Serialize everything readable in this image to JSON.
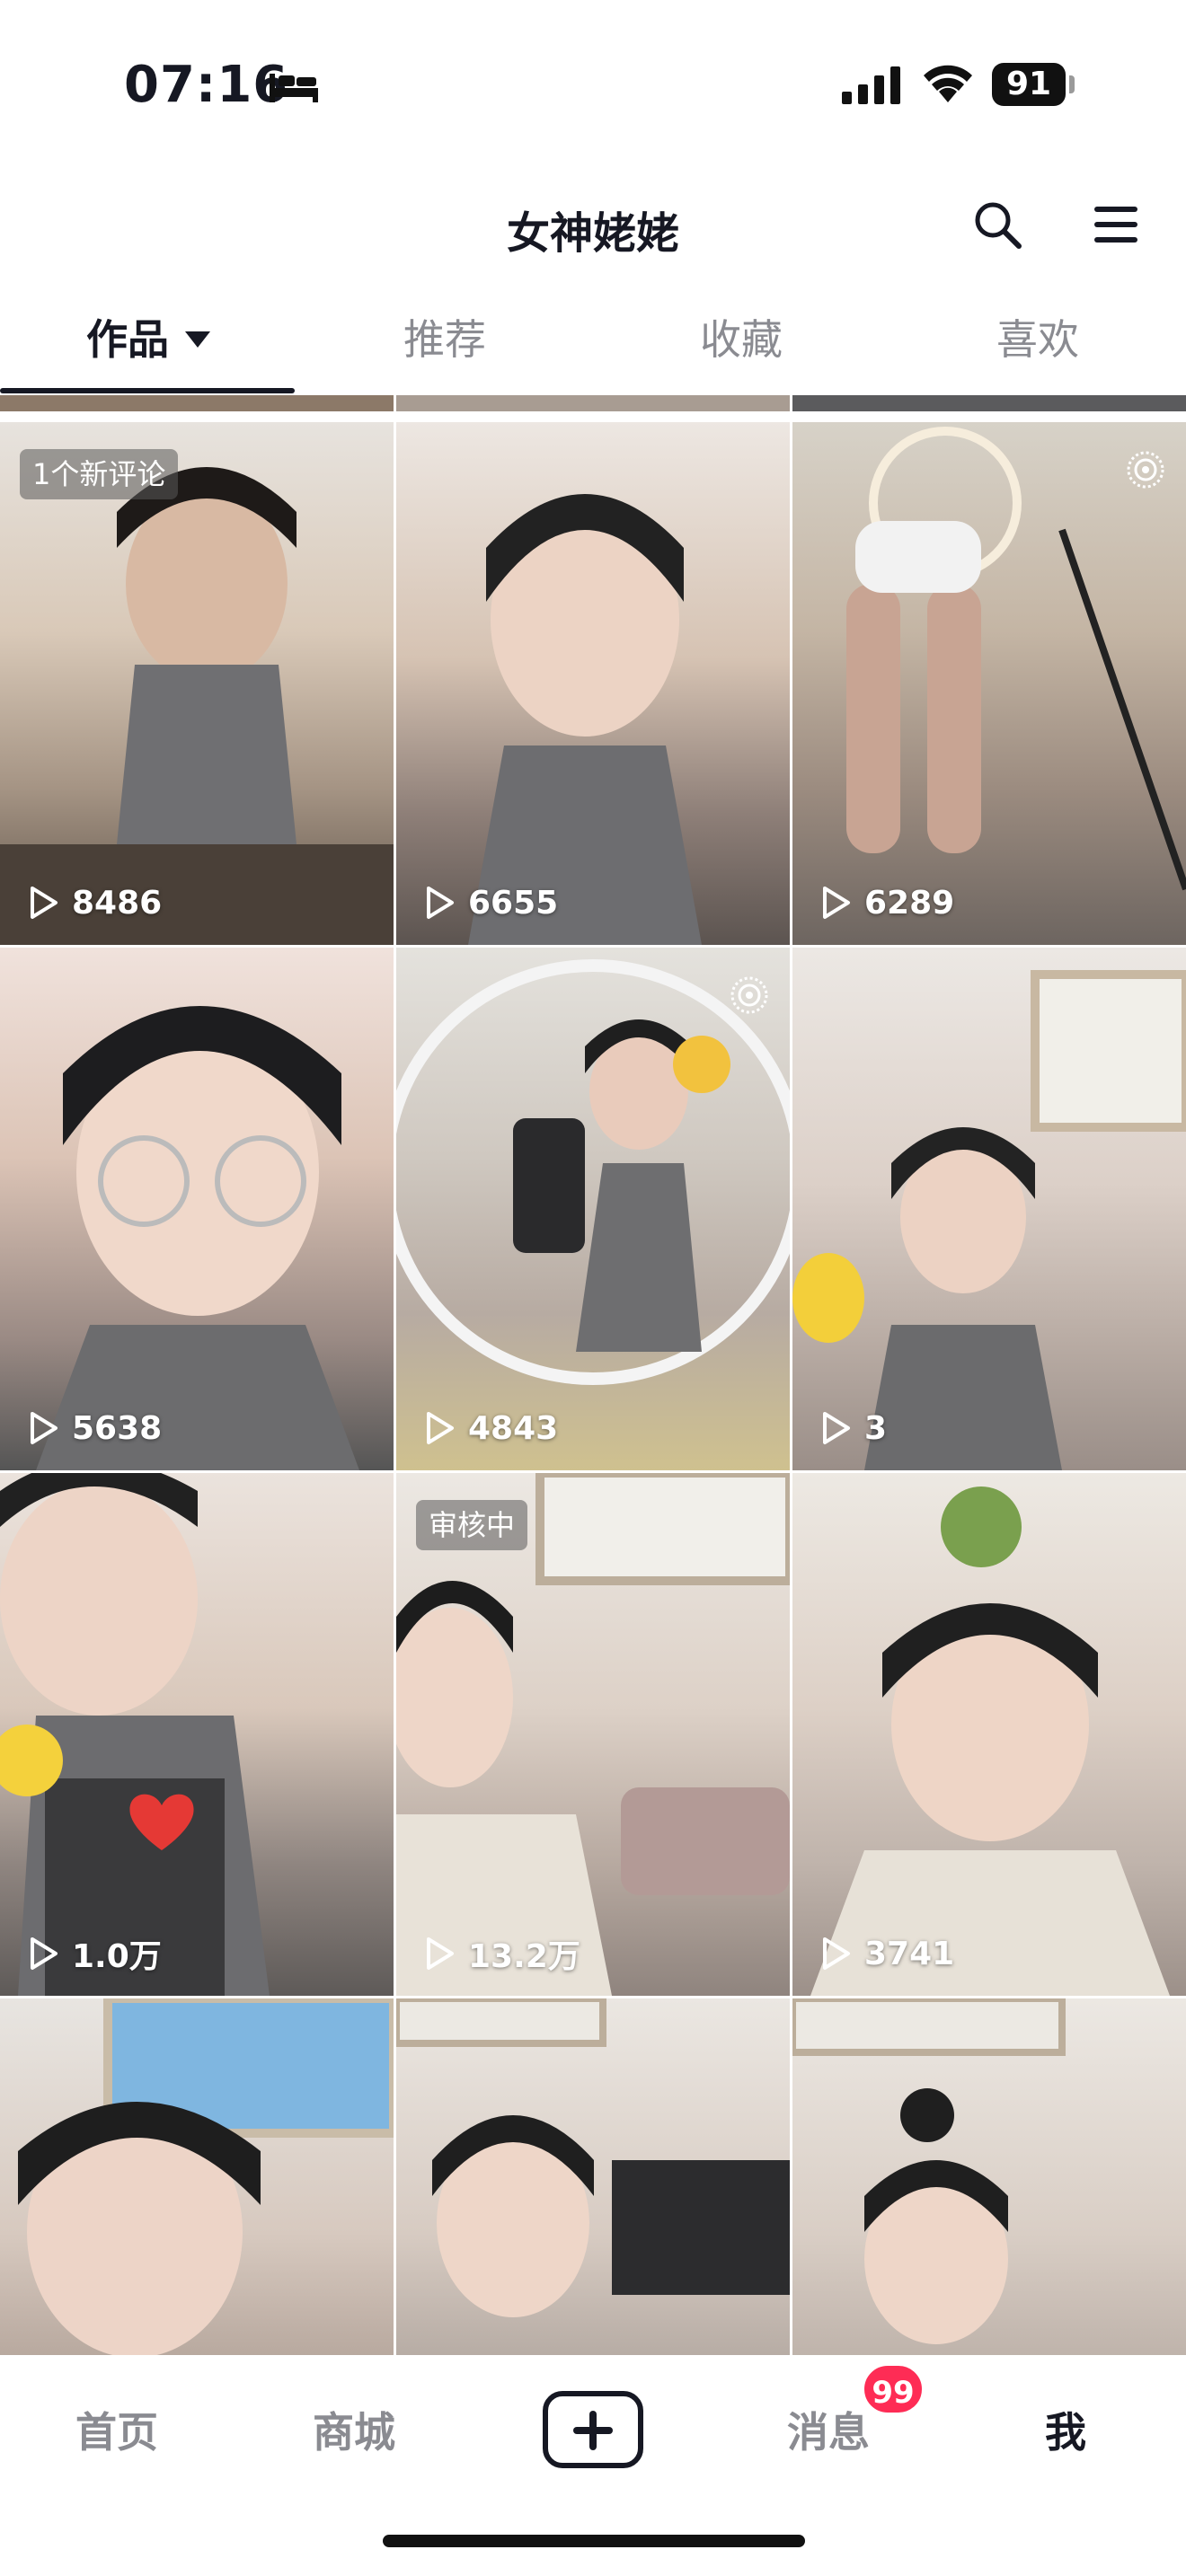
{
  "status_bar": {
    "time": "07:16",
    "battery": "91"
  },
  "header": {
    "title": "女神姥姥"
  },
  "tabs": [
    {
      "label": "作品",
      "active": true
    },
    {
      "label": "推荐"
    },
    {
      "label": "收藏"
    },
    {
      "label": "喜欢"
    }
  ],
  "grid": [
    {
      "plays": "8486",
      "badge": "1个新评论"
    },
    {
      "plays": "6655"
    },
    {
      "plays": "6289",
      "icon": "live-icon"
    },
    {
      "plays": "5638"
    },
    {
      "plays": "4843",
      "icon": "live-icon"
    },
    {
      "plays": "3"
    },
    {
      "plays": "1.0万"
    },
    {
      "plays": "13.2万",
      "badge": "审核中"
    },
    {
      "plays": "3741"
    },
    {},
    {},
    {}
  ],
  "bottom_nav": {
    "home": "首页",
    "mall": "商城",
    "messages": "消息",
    "messages_badge": "99",
    "me": "我"
  },
  "colors": {
    "accent": "#fe2c55",
    "text": "#161823",
    "muted": "#8a8b91"
  }
}
